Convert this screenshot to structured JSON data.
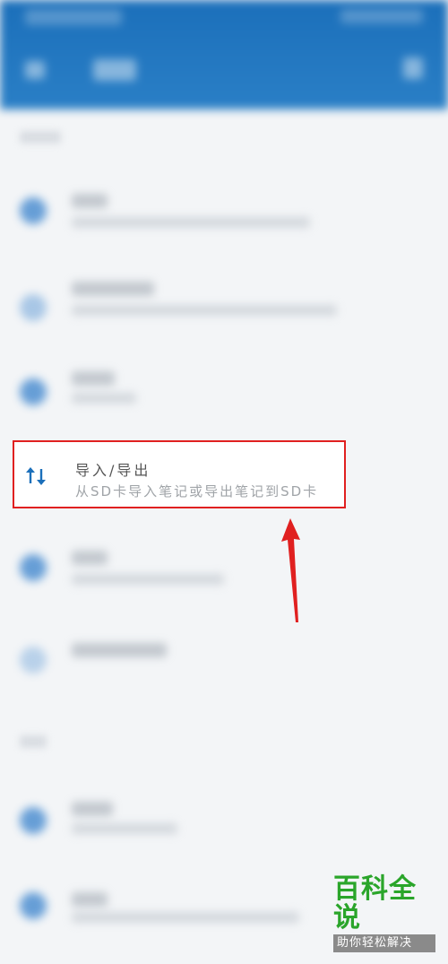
{
  "highlight_item": {
    "title": "导入/导出",
    "subtitle": "从SD卡导入笔记或导出笔记到SD卡",
    "icon": "import-export-icon",
    "icon_color": "#1b6fba"
  },
  "annotation": {
    "box_color": "#e02020",
    "arrow_color": "#e02020"
  },
  "watermark": {
    "main": "百科全说",
    "sub": "助你轻松解决",
    "color": "#2aa52a"
  },
  "theme": {
    "appbar_color": "#1b6fba"
  }
}
